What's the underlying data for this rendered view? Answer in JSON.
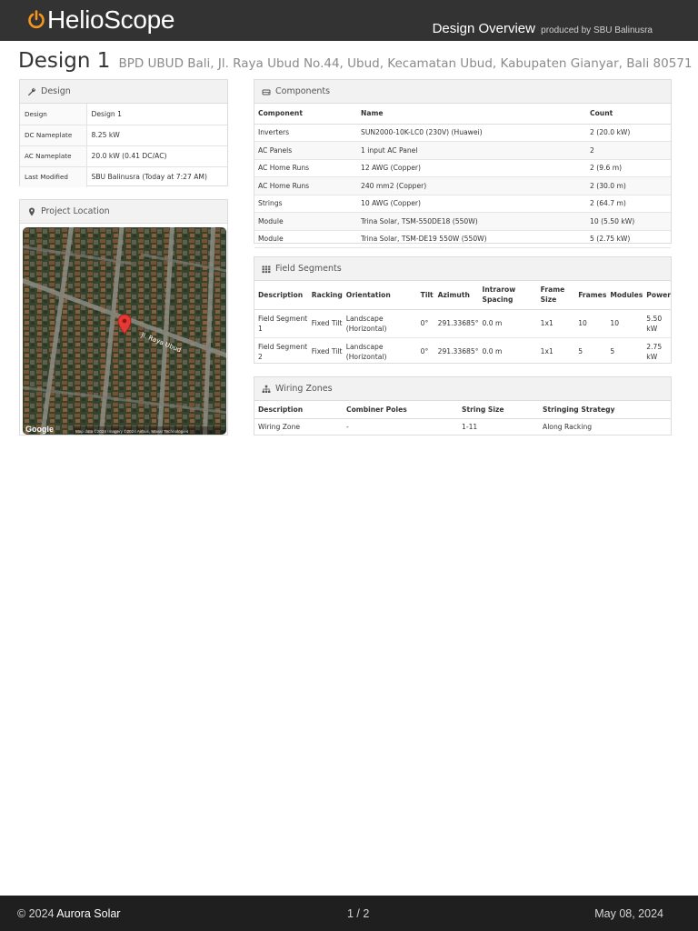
{
  "header": {
    "brand": "HelioScope",
    "report_title": "Design Overview",
    "produced_by": "produced by SBU Balinusra"
  },
  "title": {
    "design_name": "Design 1",
    "project_address": "BPD UBUD Bali, Jl. Raya Ubud No.44, Ubud, Kecamatan Ubud, Kabupaten Gianyar, Bali 80571"
  },
  "design_panel": {
    "heading": "Design",
    "rows": [
      {
        "key": "Design",
        "value": "Design 1"
      },
      {
        "key": "DC Nameplate",
        "value": "8.25 kW"
      },
      {
        "key": "AC Nameplate",
        "value": "20.0 kW (0.41 DC/AC)"
      },
      {
        "key": "Last Modified",
        "value": "SBU Balinusra (Today at 7:27 AM)"
      }
    ]
  },
  "location_panel": {
    "heading": "Project Location",
    "map_labels": {
      "street_main": "Jl. Raya Ubud",
      "google": "Google",
      "attribution": "Map data ©2024 Imagery ©2024 Airbus, Maxar Technologies"
    }
  },
  "components_panel": {
    "heading": "Components",
    "columns": [
      "Component",
      "Name",
      "Count"
    ],
    "rows": [
      [
        "Inverters",
        "SUN2000-10K-LC0 (230V) (Huawei)",
        "2 (20.0 kW)"
      ],
      [
        "AC Panels",
        "1 input AC Panel",
        "2"
      ],
      [
        "AC Home Runs",
        "12 AWG (Copper)",
        "2 (9.6 m)"
      ],
      [
        "AC Home Runs",
        "240 mm2 (Copper)",
        "2 (30.0 m)"
      ],
      [
        "Strings",
        "10 AWG (Copper)",
        "2 (64.7 m)"
      ],
      [
        "Module",
        "Trina Solar, TSM-550DE18 (550W)",
        "10 (5.50 kW)"
      ],
      [
        "Module",
        "Trina Solar, TSM-DE19 550W (550W)",
        "5 (2.75 kW)"
      ]
    ]
  },
  "segments_panel": {
    "heading": "Field Segments",
    "columns": [
      "Description",
      "Racking",
      "Orientation",
      "Tilt",
      "Azimuth",
      "Intrarow Spacing",
      "Frame Size",
      "Frames",
      "Modules",
      "Power"
    ],
    "rows": [
      [
        "Field Segment 1",
        "Fixed Tilt",
        "Landscape (Horizontal)",
        "0°",
        "291.33685°",
        "0.0 m",
        "1x1",
        "10",
        "10",
        "5.50 kW"
      ],
      [
        "Field Segment 2",
        "Fixed Tilt",
        "Landscape (Horizontal)",
        "0°",
        "291.33685°",
        "0.0 m",
        "1x1",
        "5",
        "5",
        "2.75 kW"
      ]
    ]
  },
  "wiring_panel": {
    "heading": "Wiring Zones",
    "columns": [
      "Description",
      "Combiner Poles",
      "String Size",
      "Stringing Strategy"
    ],
    "rows": [
      [
        "Wiring Zone",
        "-",
        "1-11",
        "Along Racking"
      ]
    ]
  },
  "footer": {
    "copyright": "© 2024",
    "company": "Aurora Solar",
    "page": "1 / 2",
    "date": "May 08, 2024"
  },
  "colors": {
    "header_bg": "#333333",
    "logo_accent": "#f7941d",
    "footer_bg": "#1f1f1f",
    "map_pin": "#e53935"
  }
}
